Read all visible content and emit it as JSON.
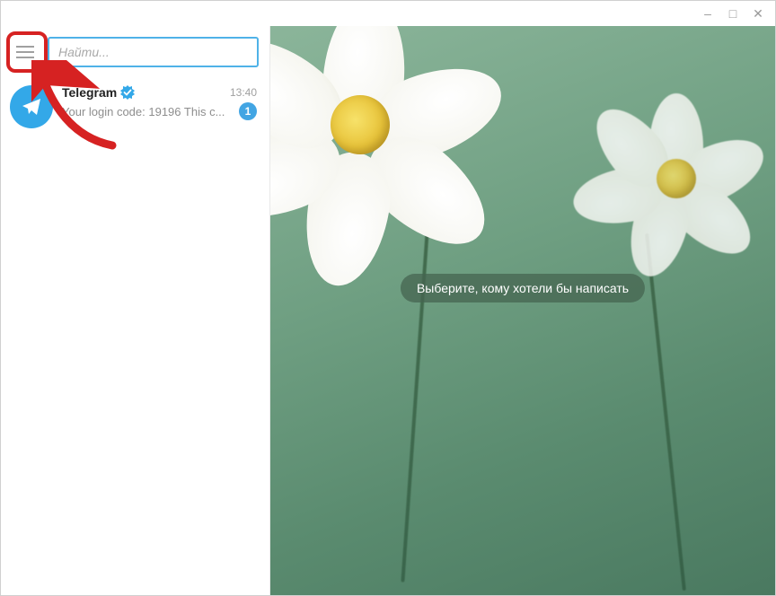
{
  "titlebar": {
    "minimize": "–",
    "maximize": "□",
    "close": "✕"
  },
  "search": {
    "placeholder": "Найти..."
  },
  "chats": [
    {
      "name": "Telegram",
      "verified": true,
      "time": "13:40",
      "preview": "Your login code: 19196  This c...",
      "unread": "1"
    }
  ],
  "main": {
    "placeholder_text": "Выберите, кому хотели бы написать"
  }
}
